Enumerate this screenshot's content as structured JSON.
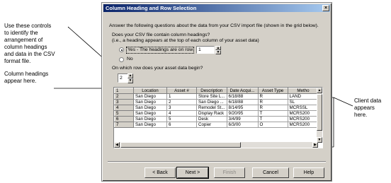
{
  "annotations": {
    "controls": [
      "Use these controls",
      "to identify the",
      "arrangement of",
      "column headings",
      "and data in the CSV",
      "format file."
    ],
    "headings": [
      "Column headings",
      "appear here."
    ],
    "client": [
      "Client data",
      "appears",
      "here."
    ]
  },
  "dialog": {
    "title": "Column Heading and Row Selection",
    "close_glyph": "×",
    "intro": "Answer the following questions about the data from your CSV import file (shown in the grid below).",
    "q1": "Does your CSV file contain column headings?",
    "q1_hint": "(i.e., a heading appears at the top of each column of your asset data)",
    "yes_label": "Yes - The headings are on row",
    "yes_row_value": "1",
    "no_label": "No",
    "q2": "On which row does your asset data begin?",
    "data_row_value": "2"
  },
  "grid": {
    "columns": [
      "",
      "Location",
      "Asset #",
      "Description",
      "Date Acqui...",
      "Asset Type",
      "Metho"
    ],
    "rows": [
      [
        "1",
        "Location",
        "Asset #",
        "Description",
        "Date Acqui...",
        "Asset Type",
        "Metho"
      ],
      [
        "2",
        "San Diego",
        "1",
        "Store Site L...",
        "6/18/88",
        "R",
        "LAND"
      ],
      [
        "3",
        "San Diego",
        "2",
        "San Diego ...",
        "6/18/88",
        "R",
        "SL"
      ],
      [
        "4",
        "San Diego",
        "3",
        "Remodel St...",
        "8/14/95",
        "R",
        "MCRSSL"
      ],
      [
        "5",
        "San Diego",
        "4",
        "Display Rack",
        "9/20/95",
        "T",
        "MCRS200"
      ],
      [
        "6",
        "San Diego",
        "5",
        "Desk",
        "3/4/99",
        "T",
        "MCRS200"
      ],
      [
        "7",
        "San Diego",
        "6",
        "Copier",
        "6/3/00",
        "O",
        "MCRS200"
      ]
    ]
  },
  "buttons": {
    "back": "< Back",
    "next": "Next >",
    "finish": "Finish",
    "cancel": "Cancel",
    "help": "Help"
  }
}
